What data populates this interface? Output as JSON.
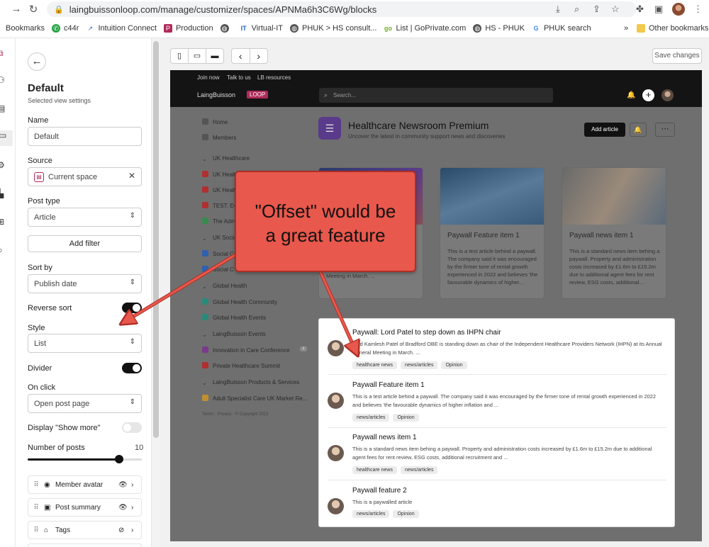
{
  "browser": {
    "url": "laingbuissonloop.com/manage/customizer/spaces/APNMa6h3C6Wg/blocks",
    "bookmarks": [
      "Bookmarks",
      "c44r",
      "Intuition Connect",
      "Production",
      "Virtual-IT",
      "PHUK > HS consult...",
      "List | GoPrivate.com",
      "HS - PHUK",
      "PHUK search"
    ],
    "more": "»",
    "other_bookmarks": "Other bookmarks"
  },
  "sidebar": {
    "title": "Default",
    "subtitle": "Selected view settings",
    "name_label": "Name",
    "name_value": "Default",
    "source_label": "Source",
    "source_value": "Current space",
    "post_type_label": "Post type",
    "post_type_value": "Article",
    "add_filter": "Add filter",
    "sort_by_label": "Sort by",
    "sort_by_value": "Publish date",
    "reverse_sort_label": "Reverse sort",
    "style_label": "Style",
    "style_value": "List",
    "divider_label": "Divider",
    "on_click_label": "On click",
    "on_click_value": "Open post page",
    "show_more_label": "Display \"Show more\"",
    "num_posts_label": "Number of posts",
    "num_posts_value": "10",
    "num_posts_fraction": 0.8,
    "blocks": [
      "Member avatar",
      "Post summary",
      "Tags"
    ],
    "toggles": {
      "reverse_sort": true,
      "divider": true,
      "show_more": false
    }
  },
  "toolbar": {
    "save": "Save changes",
    "prev": "‹",
    "next": "›"
  },
  "preview": {
    "top_links": [
      "Join now",
      "Talk to us",
      "LB resources"
    ],
    "logo_text": "LaingBuisson",
    "logo_badge": "LOOP",
    "search_placeholder": "Search...",
    "nav": [
      {
        "label": "Home",
        "color": "#555"
      },
      {
        "label": "Members",
        "color": "#555"
      },
      {
        "label": "UK Healthcare",
        "color": "#555",
        "group": true
      },
      {
        "label": "UK Healt",
        "color": "#b03030"
      },
      {
        "label": "UK Healt",
        "color": "#b03030"
      },
      {
        "label": "TEST: Ev",
        "color": "#b03030"
      },
      {
        "label": "The Adm",
        "color": "#3a8a50"
      },
      {
        "label": "UK Socia",
        "color": "#555",
        "group": true
      },
      {
        "label": "Social C",
        "color": "#3060b0"
      },
      {
        "label": "Social C",
        "color": "#3060b0"
      },
      {
        "label": "Global Health",
        "color": "#555",
        "group": true
      },
      {
        "label": "Global Health Community",
        "color": "#2a8a7a"
      },
      {
        "label": "Global Health Events",
        "color": "#2a8a7a"
      },
      {
        "label": "LaingBuisson Events",
        "color": "#555",
        "group": true
      },
      {
        "label": "Innovation in Care Conference",
        "color": "#7a3a8a"
      },
      {
        "label": "Private Healthcare Summit",
        "color": "#b03030"
      },
      {
        "label": "LaingBuisson Products & Services",
        "color": "#555",
        "group": true
      },
      {
        "label": "Adult Specialist Care UK Market Re...",
        "color": "#c09030"
      }
    ],
    "nav_badge": "4",
    "footer": "Terms · Privacy · © Copyright 2023",
    "space_title": "Healthcare Newsroom Premium",
    "space_subtitle": "Uncover the latest in community support news and discoveries",
    "add_article": "Add article",
    "cards": [
      {
        "title": "",
        "desc": "Independent Healthcare Providers Network (IHPN) at its Annual General Meeting in March. ..."
      },
      {
        "title": "Paywall Feature item 1",
        "desc": "This is a test article behind a paywall. The company said it was encouraged by the firmer tone of rental growth experienced in 2022 and believes 'the favourable dynamics of higher..."
      },
      {
        "title": "Paywall news item 1",
        "desc": "This is a standard news item behing a paywall. Property and administration costs increased by £1.6m to £15.2m due to additional agent fees for rent review, ESG costs, additional..."
      }
    ],
    "list": [
      {
        "title": "Paywall: Lord Patel to step down as IHPN chair",
        "desc": "Lord Kamlesh Patel of Bradford OBE is standing down as chair of the Independent Healthcare Providers Network (IHPN) at its Annual General Meeting in March. ...",
        "tags": [
          "healthcare news",
          "news/articles",
          "Opinion"
        ]
      },
      {
        "title": "Paywall Feature item 1",
        "desc": "This is a test article behind a paywall. The company said it was encouraged by the firmer tone of rental growth experienced in 2022 and believes 'the favourable dynamics of higher inflation and ...",
        "tags": [
          "news/articles",
          "Opinion"
        ]
      },
      {
        "title": "Paywall news item 1",
        "desc": "This is a standard news item behing a paywall. Property and administration costs increased by £1.6m to £15.2m due to additional agent fees for rent review, ESG costs, additional recruitment and ...",
        "tags": [
          "healthcare news",
          "news/articles"
        ]
      },
      {
        "title": "Paywall feature 2",
        "desc": "This is a paywalled article",
        "tags": [
          "news/articles",
          "Opinion"
        ]
      }
    ]
  },
  "callout": {
    "line1": "\"Offset\" would be",
    "line2": "a great feature",
    "color": "#e8584c"
  }
}
